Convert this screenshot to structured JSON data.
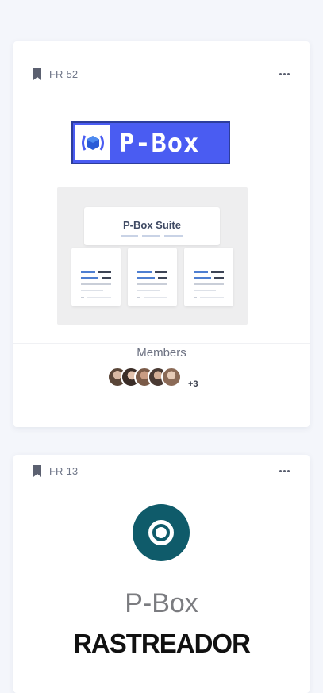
{
  "cards": [
    {
      "id": "FR-52",
      "logo_text": "P-Box",
      "suite_title": "P-Box Suite",
      "members_label": "Members",
      "members_more": "+3"
    },
    {
      "id": "FR-13",
      "title": "P-Box",
      "subtitle": "RASTREADOR"
    }
  ],
  "icons": {
    "bookmark": "bookmark-icon",
    "more": "more-horizontal-icon",
    "target": "target-icon"
  },
  "colors": {
    "brand_blue": "#4a5cf2",
    "teal": "#0f5b6a",
    "page_bg": "#f4f6fb"
  }
}
